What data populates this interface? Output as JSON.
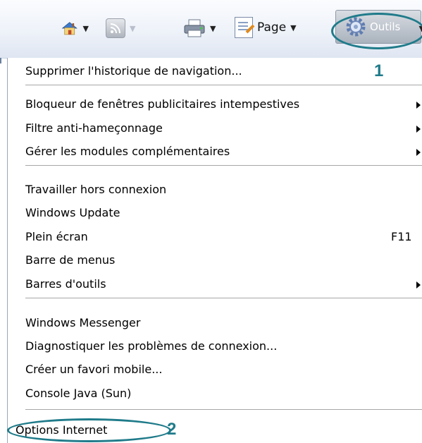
{
  "toolbar": {
    "items": [
      {
        "name": "home",
        "icon": "home-icon"
      },
      {
        "name": "feeds",
        "icon": "rss-feed-icon"
      },
      {
        "name": "print",
        "icon": "printer-icon"
      },
      {
        "name": "page",
        "icon": "page-icon",
        "label": "Page"
      },
      {
        "name": "tools",
        "icon": "gear-icon",
        "label": "Outils"
      }
    ]
  },
  "menu": {
    "groups": [
      [
        {
          "label": "Supprimer l'historique de navigation..."
        }
      ],
      [
        {
          "label": "Bloqueur de fenêtres publicitaires intempestives",
          "submenu": true
        },
        {
          "label": "Filtre anti-hameçonnage",
          "submenu": true
        },
        {
          "label": "Gérer les modules complémentaires",
          "submenu": true
        }
      ],
      [
        {
          "label": "Travailler hors connexion"
        },
        {
          "label": "Windows Update"
        },
        {
          "label": "Plein écran",
          "shortcut": "F11"
        },
        {
          "label": "Barre de menus"
        },
        {
          "label": "Barres d'outils",
          "submenu": true
        }
      ],
      [
        {
          "label": "Windows Messenger"
        },
        {
          "label": "Diagnostiquer les problèmes de connexion..."
        },
        {
          "label": "Créer un favori mobile..."
        },
        {
          "label": "Console Java (Sun)"
        }
      ],
      [
        {
          "label": "Options Internet"
        }
      ]
    ]
  },
  "annotations": {
    "step1": "1",
    "step2": "2",
    "color": "#1f7b8a"
  }
}
